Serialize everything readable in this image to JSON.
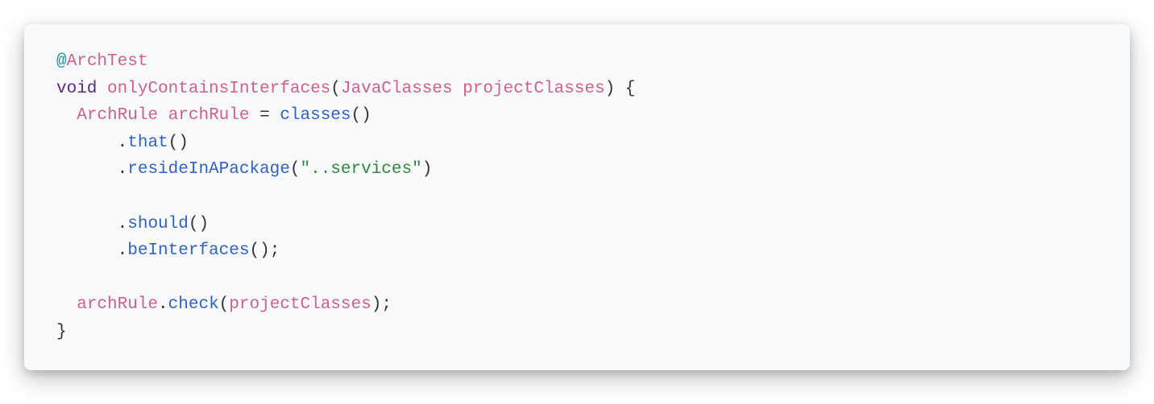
{
  "code": {
    "annotation_at": "@",
    "annotation_name": "ArchTest",
    "kw_void": "void",
    "method_name": "onlyContainsInterfaces",
    "param_type": "JavaClasses",
    "param_name": "projectClasses",
    "decl_type": "ArchRule",
    "decl_var": "archRule",
    "call_classes": "classes",
    "call_that": "that",
    "call_resideInAPackage": "resideInAPackage",
    "str_services": "\"..services\"",
    "call_should": "should",
    "call_beInterfaces": "beInterfaces",
    "stmt_var": "archRule",
    "call_check": "check",
    "arg_projectClasses": "projectClasses",
    "p_open": "(",
    "p_close": ")",
    "brace_open": "{",
    "brace_close": "}",
    "semicolon": ";",
    "dot": ".",
    "eq": " = ",
    "sp": " ",
    "nl": "\n",
    "indent1": "  ",
    "indent2": "      "
  }
}
